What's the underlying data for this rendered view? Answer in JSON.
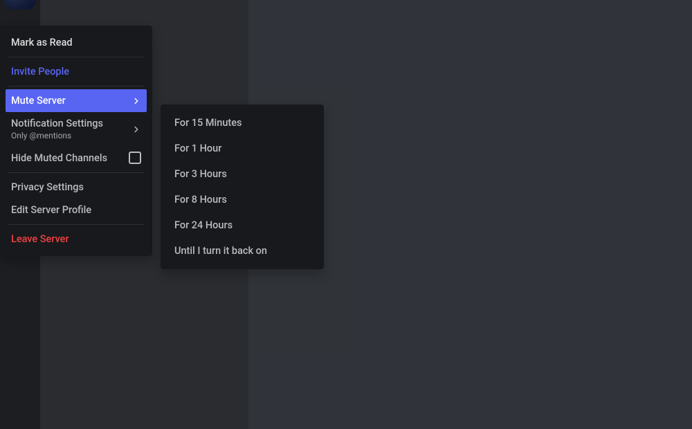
{
  "menu": {
    "mark_read": "Mark as Read",
    "invite": "Invite People",
    "mute_server": "Mute Server",
    "notification_settings": "Notification Settings",
    "notification_sub": "Only @mentions",
    "hide_muted": "Hide Muted Channels",
    "privacy": "Privacy Settings",
    "edit_profile": "Edit Server Profile",
    "leave": "Leave Server"
  },
  "submenu": {
    "opt_15m": "For 15 Minutes",
    "opt_1h": "For 1 Hour",
    "opt_3h": "For 3 Hours",
    "opt_8h": "For 8 Hours",
    "opt_24h": "For 24 Hours",
    "opt_until": "Until I turn it back on"
  },
  "colors": {
    "accent": "#5865f2",
    "danger": "#ed4245",
    "bg_menu": "#18191c",
    "bg_channel": "#2f3136",
    "bg_chat": "#36393f",
    "bg_rail": "#202225"
  }
}
